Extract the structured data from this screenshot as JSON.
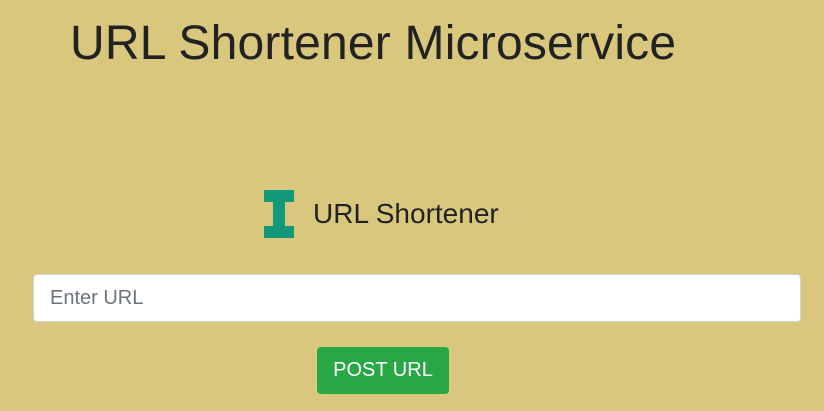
{
  "header": {
    "title": "URL Shortener Microservice"
  },
  "brand": {
    "logo_icon": "i-beam-logo-icon",
    "logo_color": "#14987a",
    "name": "URL Shortener"
  },
  "form": {
    "url_input": {
      "placeholder": "Enter URL",
      "value": ""
    },
    "submit_label": "POST URL",
    "submit_color": "#28a745"
  },
  "theme": {
    "background": "#d8c77d",
    "text_color": "#222222"
  }
}
